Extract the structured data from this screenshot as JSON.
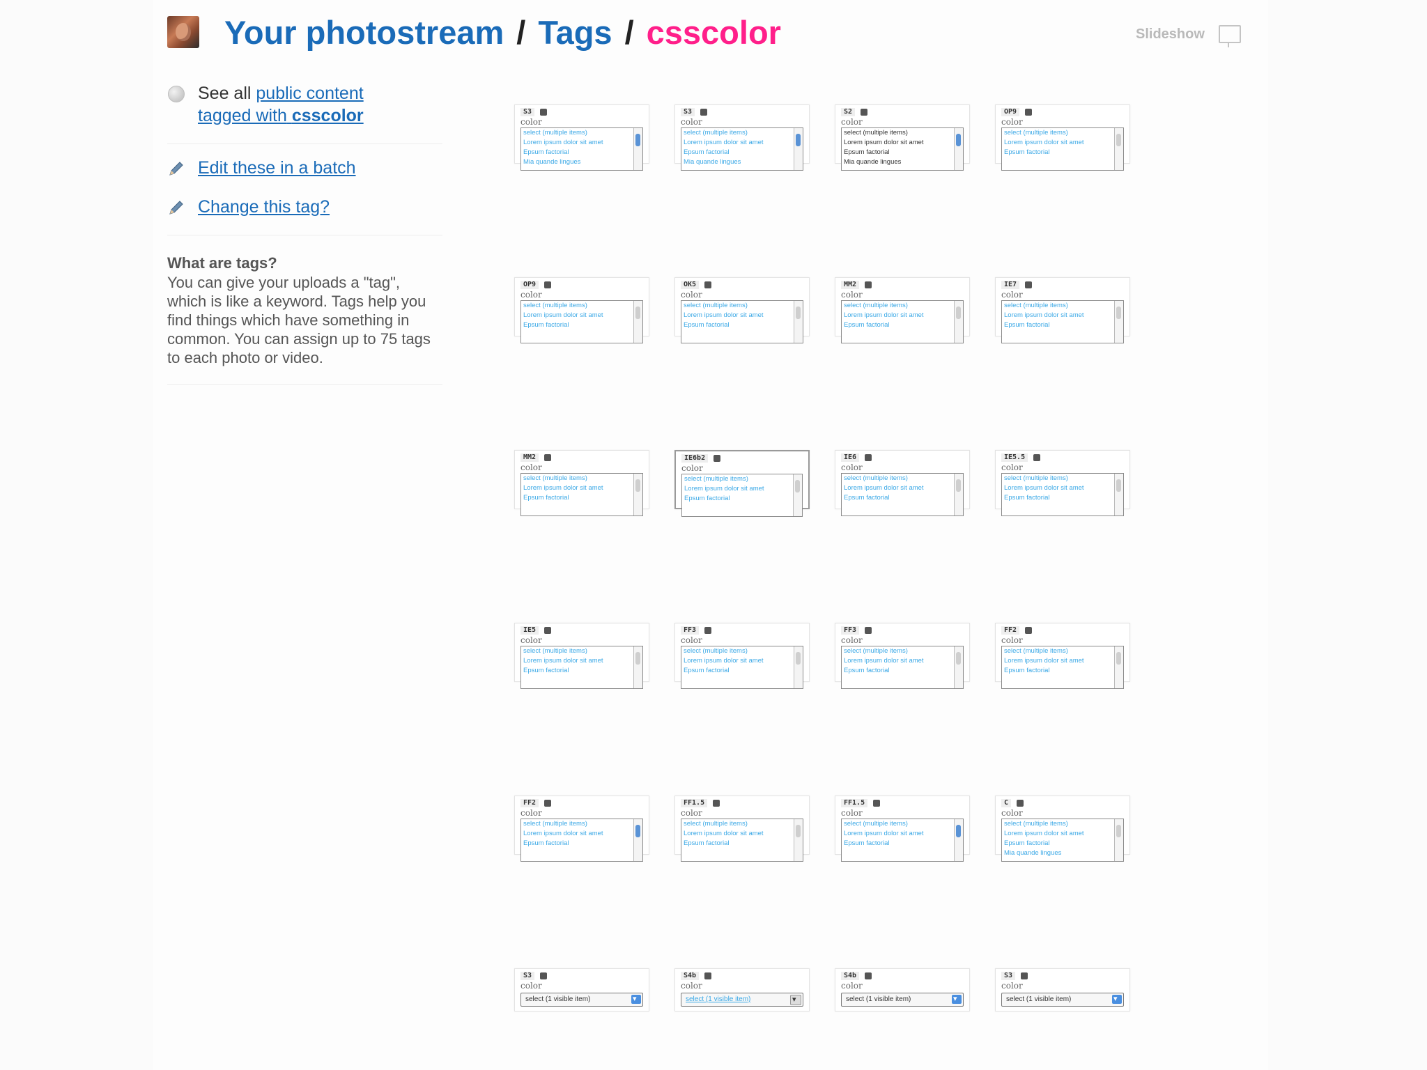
{
  "header": {
    "title_part1": "Your photostream",
    "separator": "/",
    "title_part2": "Tags",
    "current_tag": "csscolor"
  },
  "slideshow": {
    "label": "Slideshow"
  },
  "sidebar": {
    "see_all_prefix": "See all",
    "see_all_link_line1": "public content",
    "see_all_link_line2_prefix": "tagged with",
    "see_all_link_tag": "csscolor",
    "edit_batch": "Edit these in a batch",
    "change_tag": "Change this tag?",
    "help_title": "What are tags?",
    "help_body": "You can give your uploads a \"tag\", which is like a keyword. Tags help you find things which have something in common. You can assign up to 75 tags to each photo or video."
  },
  "thumb_label": "color",
  "listbox_lines": [
    "select (multiple items)",
    "Lorem ipsum dolor sit amet",
    "Epsum factorial",
    "Mia quande lingues"
  ],
  "select_text": "select (1 visible item)",
  "thumbs": [
    {
      "code": "S3"
    },
    {
      "code": "S3"
    },
    {
      "code": "S2"
    },
    {
      "code": "OP9"
    },
    {
      "code": "OP9"
    },
    {
      "code": "OK5"
    },
    {
      "code": "MM2"
    },
    {
      "code": "IE7"
    },
    {
      "code": "MM2"
    },
    {
      "code": "IE6b2"
    },
    {
      "code": "IE6"
    },
    {
      "code": "IE5.5"
    },
    {
      "code": "IE5"
    },
    {
      "code": "FF3"
    },
    {
      "code": "FF3"
    },
    {
      "code": "FF2"
    },
    {
      "code": "FF2"
    },
    {
      "code": "FF1.5"
    },
    {
      "code": "FF1.5"
    },
    {
      "code": "C"
    },
    {
      "code": "S3"
    },
    {
      "code": "S4b"
    },
    {
      "code": "S4b"
    },
    {
      "code": "S3"
    }
  ]
}
